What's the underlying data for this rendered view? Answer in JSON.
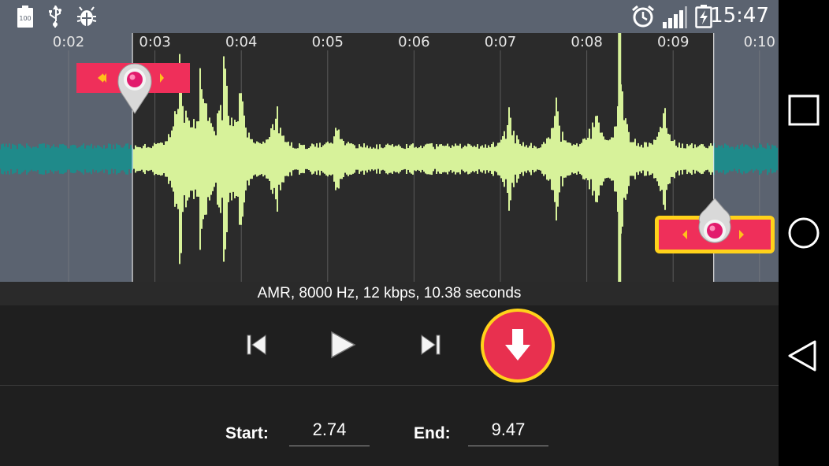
{
  "status_bar": {
    "battery_label": "100",
    "time": "15:47",
    "icons": [
      "battery-full-icon",
      "usb-icon",
      "debug-bug-icon",
      "alarm-clock-icon",
      "signal-bars-icon",
      "battery-charging-icon"
    ]
  },
  "timeline": {
    "ticks": [
      "0:02",
      "0:03",
      "0:04",
      "0:05",
      "0:06",
      "0:07",
      "0:08",
      "0:09",
      "0:10"
    ],
    "selection_start_seconds": 2.74,
    "selection_end_seconds": 9.47,
    "playhead_seconds": 8.38
  },
  "info": {
    "text": "AMR, 8000 Hz, 12 kbps, 10.38 seconds"
  },
  "controls": {
    "icons": [
      "skip-previous-icon",
      "play-icon",
      "skip-next-icon",
      "save-download-icon"
    ]
  },
  "edit": {
    "start_label": "Start:",
    "start_value": "2.74",
    "end_label": "End:",
    "end_value": "9.47"
  },
  "colors": {
    "status_bar": "#5b6370",
    "waveform_selected": "#d7f29a",
    "waveform_unselected": "#1f8a8a",
    "marker_red": "#ef2f5a",
    "accent_yellow": "#ffd21a"
  },
  "nav": {
    "icons": [
      "recent-apps-icon",
      "home-icon",
      "back-icon"
    ]
  }
}
